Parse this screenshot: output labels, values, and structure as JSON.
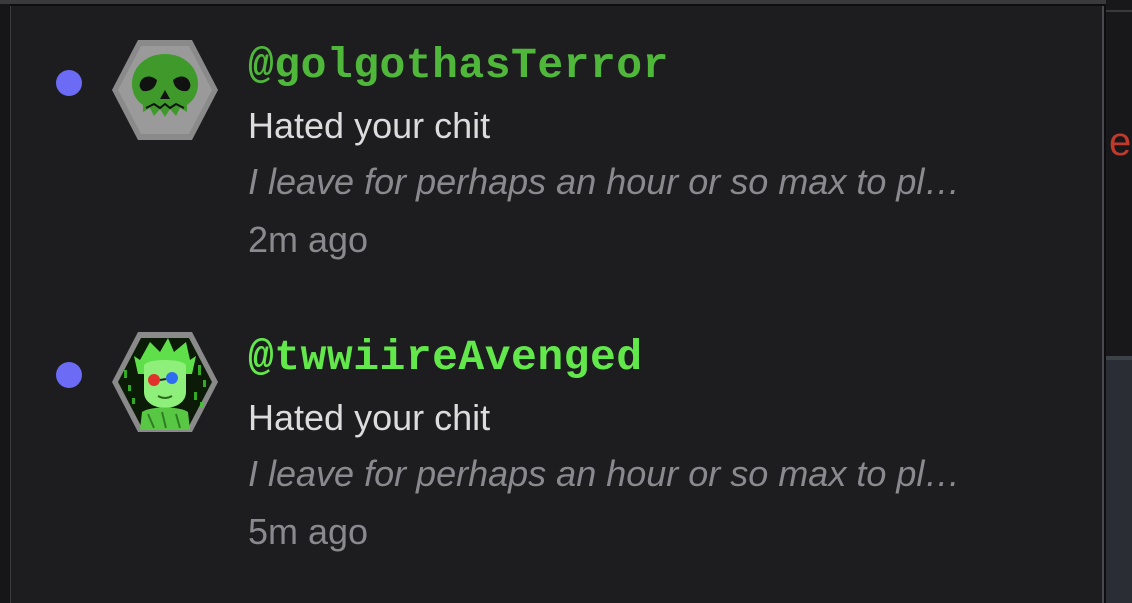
{
  "notifications": [
    {
      "username": "@golgothasTerror",
      "action": "Hated your chit",
      "preview": "I leave for perhaps an hour or so max to pl…",
      "time": "2m ago",
      "unread": true,
      "avatar_icon": "skull-icon"
    },
    {
      "username": "@twwiireAvenged",
      "action": "Hated your chit",
      "preview": "I leave for perhaps an hour or so max to pl…",
      "time": "5m ago",
      "unread": true,
      "avatar_icon": "character-avatar-icon"
    }
  ],
  "side_fragment": "e",
  "colors": {
    "panel_bg": "#1d1d20",
    "username_1": "#4fb83a",
    "username_2": "#62e84a",
    "unread_dot": "#6b6bf5",
    "avatar_frame": "#8a8a8a",
    "fragment": "#c0392b"
  }
}
